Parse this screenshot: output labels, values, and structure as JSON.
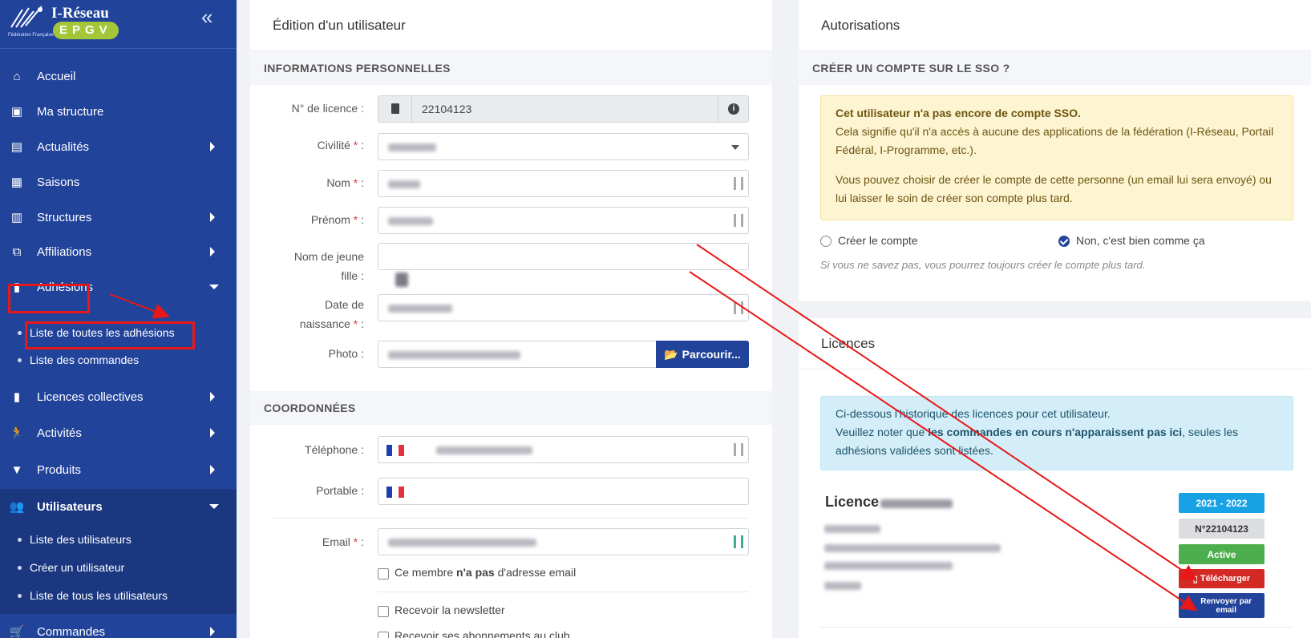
{
  "brand": {
    "name": "I-Réseau",
    "badge": "EPGV",
    "subtitle": "Fédération Française"
  },
  "sidebar": {
    "items": [
      {
        "label": "Accueil",
        "icon": "home-icon"
      },
      {
        "label": "Ma structure",
        "icon": "id-card-icon"
      },
      {
        "label": "Actualités",
        "icon": "newspaper-icon"
      },
      {
        "label": "Saisons",
        "icon": "calendar-icon"
      },
      {
        "label": "Structures",
        "icon": "building-icon"
      },
      {
        "label": "Affiliations",
        "icon": "sitemap-icon"
      },
      {
        "label": "Adhésions",
        "icon": "id-badge-icon"
      },
      {
        "label": "Licences collectives",
        "icon": "id-badge-icon"
      },
      {
        "label": "Activités",
        "icon": "running-icon"
      },
      {
        "label": "Produits",
        "icon": "bookmark-icon"
      },
      {
        "label": "Utilisateurs",
        "icon": "users-icon"
      },
      {
        "label": "Commandes",
        "icon": "cart-icon"
      }
    ],
    "adhesions_sub": [
      "Liste de toutes les adhésions",
      "Liste des commandes"
    ],
    "utilisateurs_sub": [
      "Liste des utilisateurs",
      "Créer un utilisateur",
      "Liste de tous les utilisateurs"
    ]
  },
  "form": {
    "title": "Édition d'un utilisateur",
    "section_personal": "INFORMATIONS PERSONNELLES",
    "license_label": "N° de licence :",
    "license_value": "22104123",
    "civilite_label": "Civilité",
    "nom_label": "Nom",
    "prenom_label": "Prénom",
    "nom_jeune_fille_label": "Nom de jeune fille :",
    "date_naissance_label": "Date de naissance",
    "photo_label": "Photo :",
    "browse_button": "Parcourir...",
    "section_contact": "COORDONNÉES",
    "telephone_label": "Téléphone :",
    "portable_label": "Portable :",
    "email_label": "Email",
    "no_email_checkbox": [
      "Ce membre ",
      "n'a pas",
      " d'adresse email"
    ],
    "newsletter_checkbox": "Recevoir la newsletter",
    "subscription_checkbox": "Recevoir ses abonnements au club"
  },
  "authorizations": {
    "title": "Autorisations",
    "section": "CRÉER UN COMPTE SUR LE SSO ?",
    "alert_title": "Cet utilisateur n'a pas encore de compte SSO.",
    "alert_line1": "Cela signifie qu'il n'a accès à aucune des applications de la fédération (I-Réseau, Portail Fédéral, I-Programme, etc.).",
    "alert_line2": "Vous pouvez choisir de créer le compte de cette personne (un email lui sera envoyé) ou lui laisser le soin de créer son compte plus tard.",
    "radio_create": "Créer le compte",
    "radio_no": "Non, c'est bien comme ça",
    "hint": "Si vous ne savez pas, vous pourrez toujours créer le compte plus tard."
  },
  "licences": {
    "title": "Licences",
    "info_line1": "Ci-dessous l'historique des licences pour cet utilisateur.",
    "info_line2_pre": "Veuillez noter que ",
    "info_line2_bold": "les commandes en cours n'apparaissent pas ici",
    "info_line2_post": ", seules les adhésions validées sont listées.",
    "card_title": "Licence",
    "season": "2021 - 2022",
    "number": "N°22104123",
    "status": "Active",
    "download": "Télécharger",
    "resend": "Renvoyer par email"
  },
  "colors": {
    "sidebar": "#21439a",
    "primary": "#21439a",
    "season": "#17a2e6",
    "active": "#4cae4c",
    "download": "#d32a26",
    "annotation": "#e81818"
  }
}
